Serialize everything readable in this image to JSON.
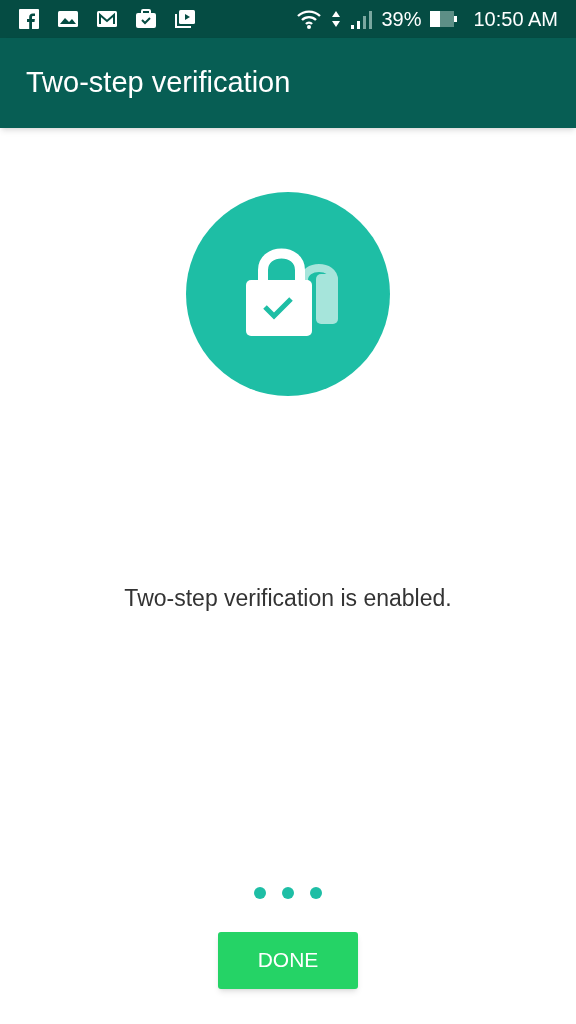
{
  "status_bar": {
    "battery": "39%",
    "time": "10:50 AM"
  },
  "app_bar": {
    "title": "Two-step verification"
  },
  "message": "Two-step verification is enabled.",
  "button": "DONE"
}
